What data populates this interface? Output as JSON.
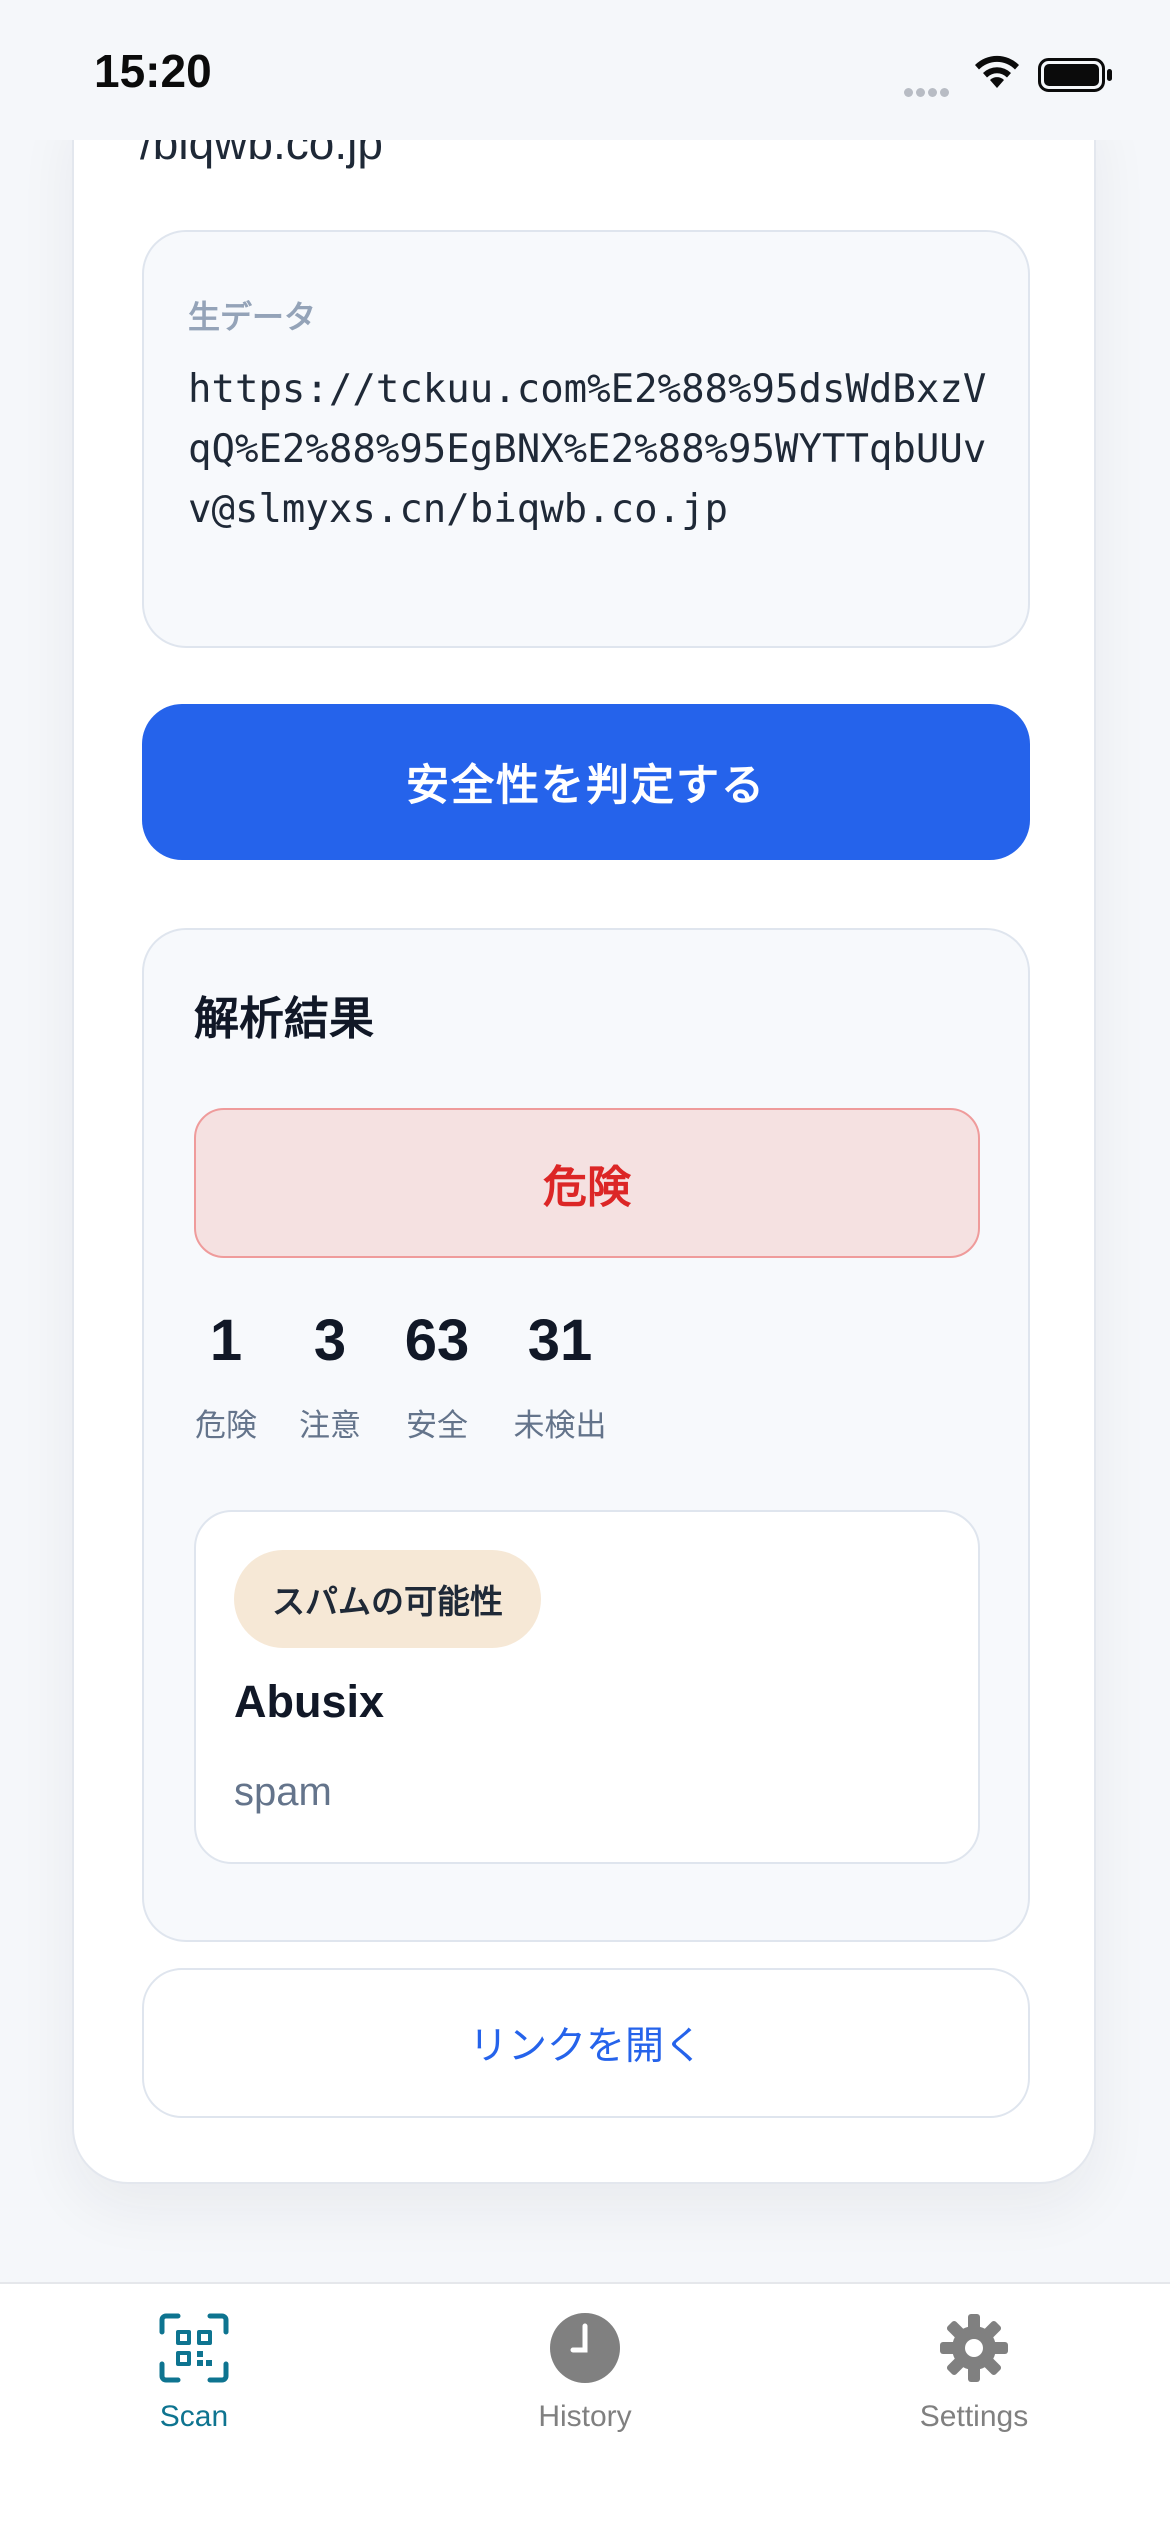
{
  "status_bar": {
    "time": "15:20"
  },
  "previous_text": "/biqwb.co.jp",
  "raw_data": {
    "label": "生データ",
    "value": "https://tckuu.com%E2%88%95dsWdBxzVqQ%E2%88%95EgBNX%E2%88%95WYTTqbUUvv@slmyxs.cn/biqwb.co.jp"
  },
  "check_button_label": "安全性を判定する",
  "result": {
    "title": "解析結果",
    "verdict": "危険",
    "stats": [
      {
        "value": "1",
        "label": "危険"
      },
      {
        "value": "3",
        "label": "注意"
      },
      {
        "value": "63",
        "label": "安全"
      },
      {
        "value": "31",
        "label": "未検出"
      }
    ],
    "engine": {
      "badge": "スパムの可能性",
      "name": "Abusix",
      "result": "spam"
    }
  },
  "open_link_label": "リンクを開く",
  "tabs": [
    {
      "label": "Scan",
      "icon": "qr-scan-icon",
      "active": true
    },
    {
      "label": "History",
      "icon": "clock-icon",
      "active": false
    },
    {
      "label": "Settings",
      "icon": "gear-icon",
      "active": false
    }
  ],
  "colors": {
    "accent": "#2563eb",
    "danger": "#dc2626",
    "danger_bg": "#f5e1e1",
    "tab_active": "#0e7490",
    "tab_inactive": "#808080"
  }
}
